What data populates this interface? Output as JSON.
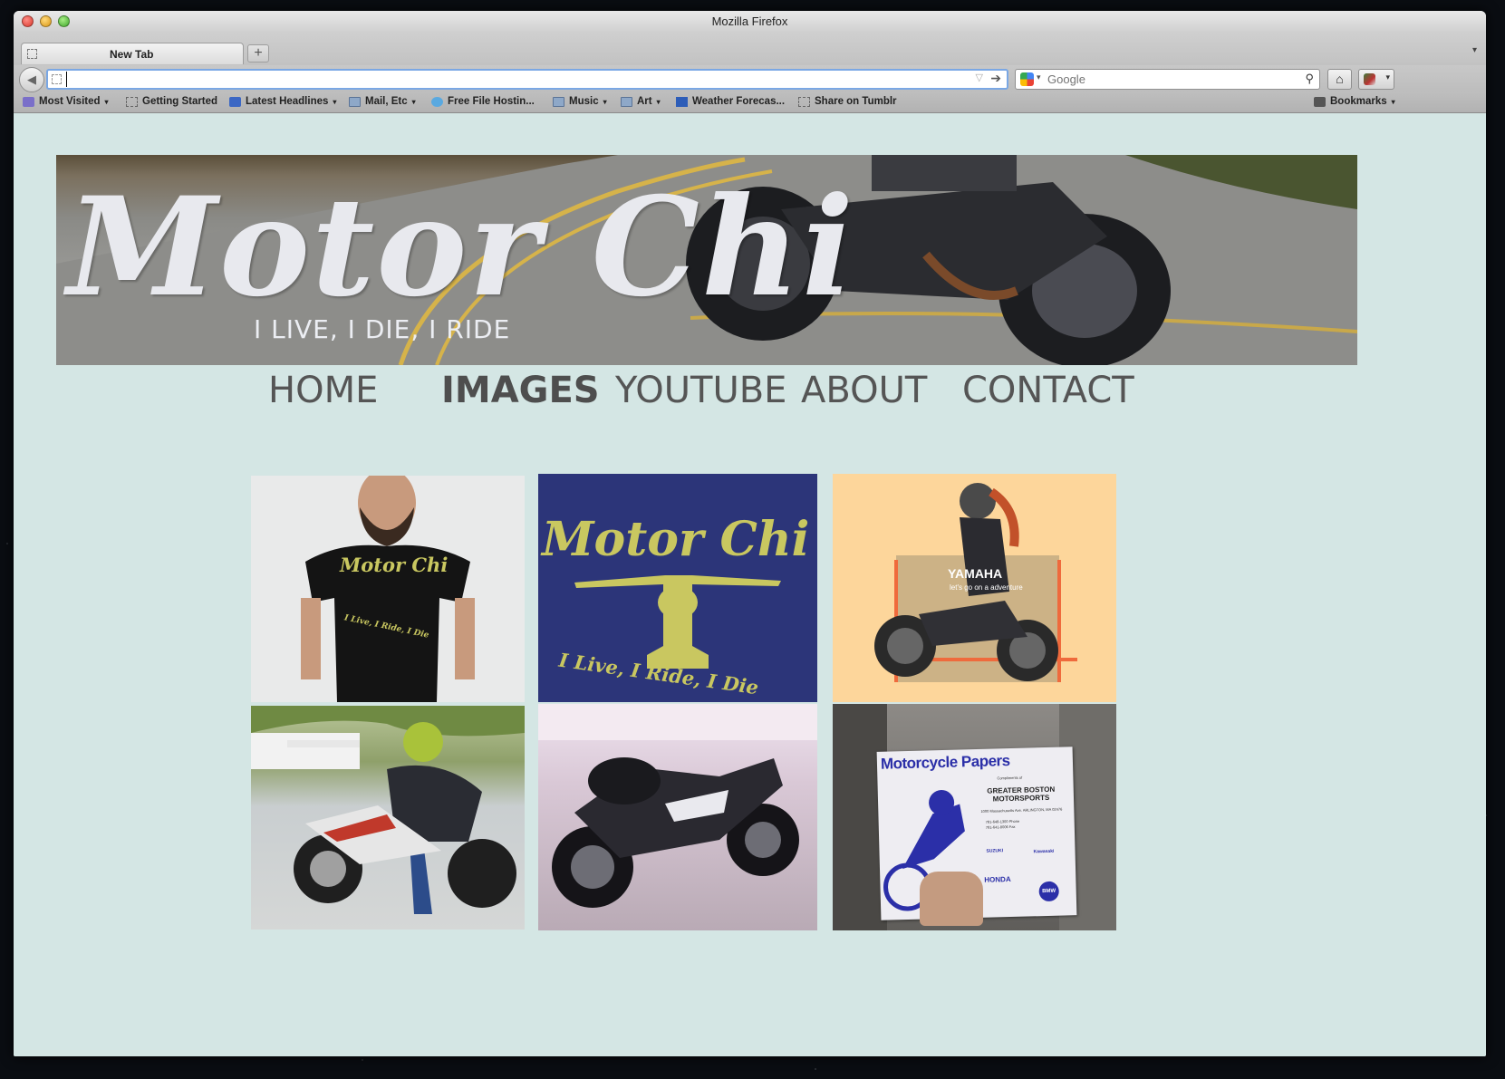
{
  "window": {
    "title": "Mozilla Firefox"
  },
  "tabs": [
    {
      "label": "New Tab"
    }
  ],
  "toolbar": {
    "back_icon": "back-arrow-icon",
    "url_value": "",
    "search_placeholder": "Google",
    "home_icon": "home-icon"
  },
  "bookmarks": [
    {
      "label": "Most Visited",
      "icon": "most-visited-icon",
      "menu": true
    },
    {
      "label": "Getting Started",
      "icon": "page-icon",
      "menu": false
    },
    {
      "label": "Latest Headlines",
      "icon": "rss-icon",
      "menu": true
    },
    {
      "label": "Mail, Etc",
      "icon": "folder-icon",
      "menu": true
    },
    {
      "label": "Free File Hostin...",
      "icon": "cloud-icon",
      "menu": false
    },
    {
      "label": "Music",
      "icon": "folder-icon",
      "menu": true
    },
    {
      "label": "Art",
      "icon": "folder-icon",
      "menu": true
    },
    {
      "label": "Weather Forecas...",
      "icon": "weather-icon",
      "menu": false
    },
    {
      "label": "Share on Tumblr",
      "icon": "page-icon",
      "menu": false
    }
  ],
  "bookmarks_menu": {
    "label": "Bookmarks"
  },
  "site": {
    "logo_text": "Motor Chi",
    "tagline": "I LIVE, I DIE, I RIDE",
    "nav": [
      {
        "label": "HOME",
        "active": false
      },
      {
        "label": "IMAGES",
        "active": true
      },
      {
        "label": "YOUTUBE",
        "active": false
      },
      {
        "label": "ABOUT",
        "active": false
      },
      {
        "label": "CONTACT",
        "active": false
      }
    ],
    "gallery": {
      "tshirt": {
        "logo": "Motor Chi",
        "motto": "I Live, I Ride, I Die"
      },
      "poster": {
        "logo": "Motor Chi",
        "motto": "I Live, I Ride, I Die"
      },
      "yamaha": {
        "brand": "YAMAHA",
        "slogan": "let's go on a adventure"
      },
      "papers": {
        "title": "Motorcycle Papers",
        "compliments": "Compliments of",
        "dealer": "GREATER BOSTON MOTORSPORTS",
        "address": "1000 Massachusetts Ave. ARLINGTON, MA 02476",
        "phone": "781-648-1300 Phone",
        "fax": "781-641-8006 Fax",
        "brands": [
          "SUZUKI",
          "Kawasaki",
          "HONDA",
          "BMW"
        ]
      }
    }
  },
  "colors": {
    "page_bg": "#d4e6e4",
    "nav_text": "#555555",
    "poster_bg": "#2c3579",
    "poster_ink": "#c9c760",
    "yamaha_bg": "#fdd69b"
  }
}
